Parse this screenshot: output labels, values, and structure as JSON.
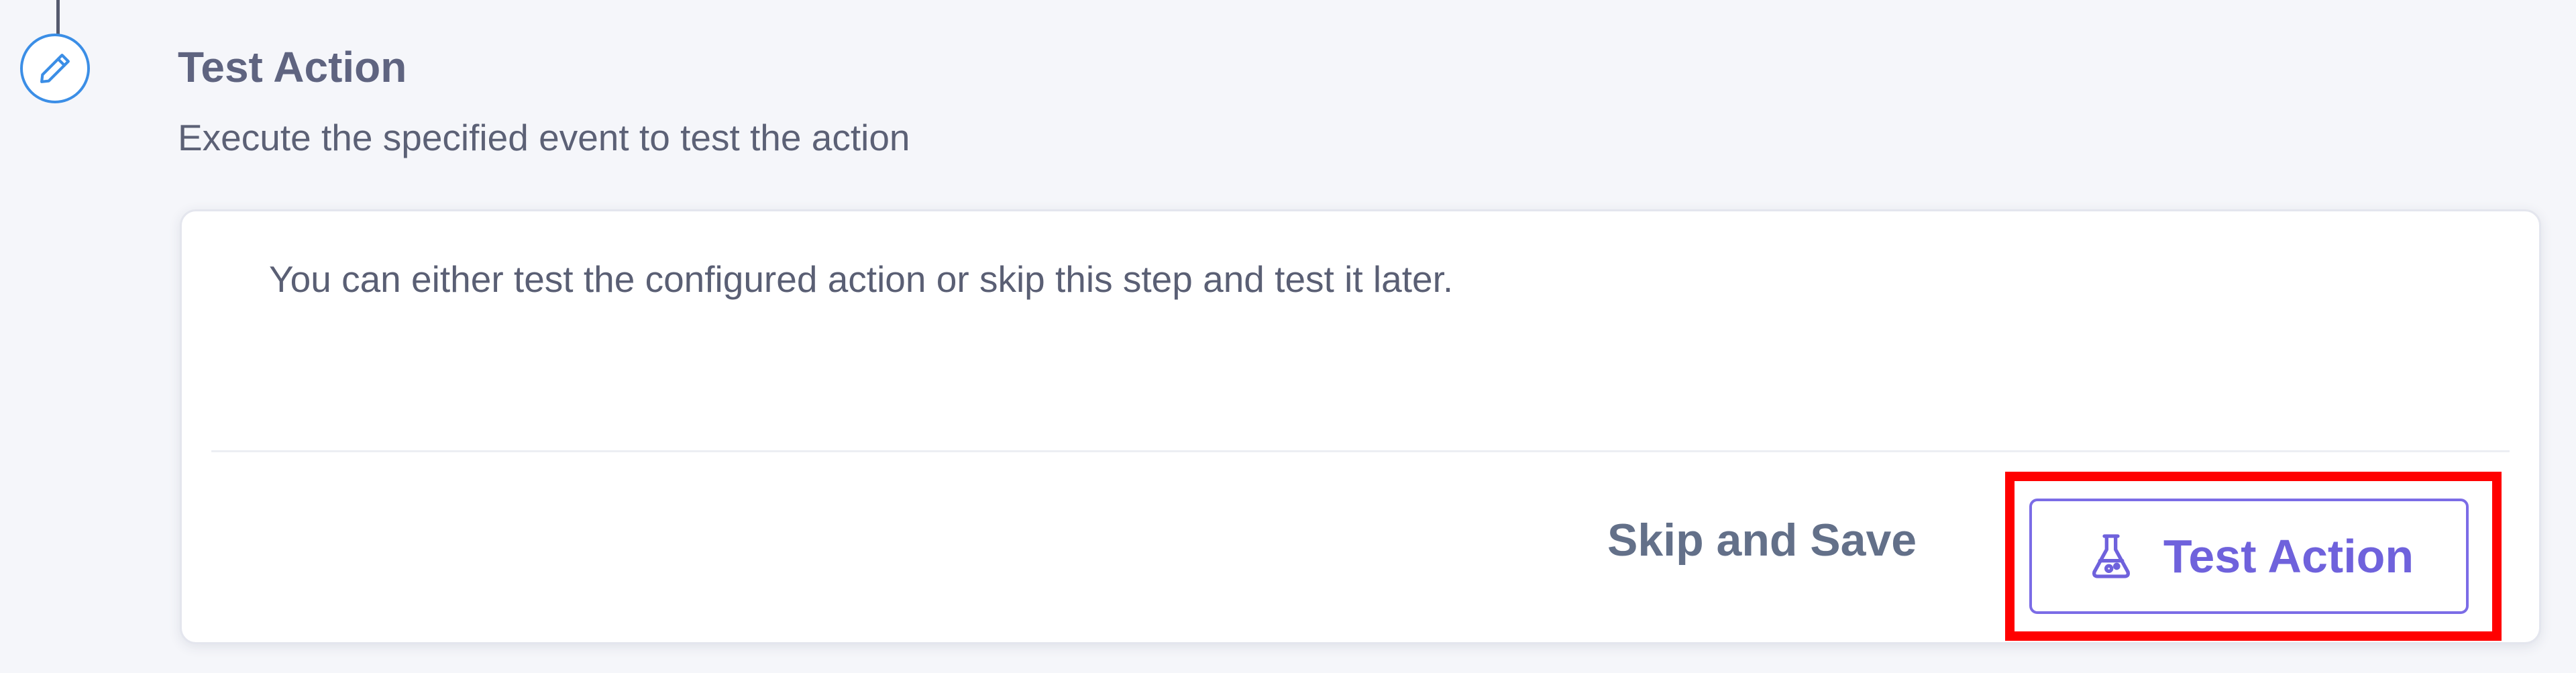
{
  "step": {
    "title": "Test Action",
    "subtitle": "Execute the specified event to test the action",
    "icon": "pencil-icon"
  },
  "card": {
    "message": "You can either test the configured action or skip this step and test it later."
  },
  "actions": {
    "skip_label": "Skip and Save",
    "test_label": "Test Action",
    "test_icon": "flask-icon"
  },
  "colors": {
    "accent": "#6f62dc",
    "step_icon": "#3b8ee6",
    "highlight": "#ff0000"
  }
}
